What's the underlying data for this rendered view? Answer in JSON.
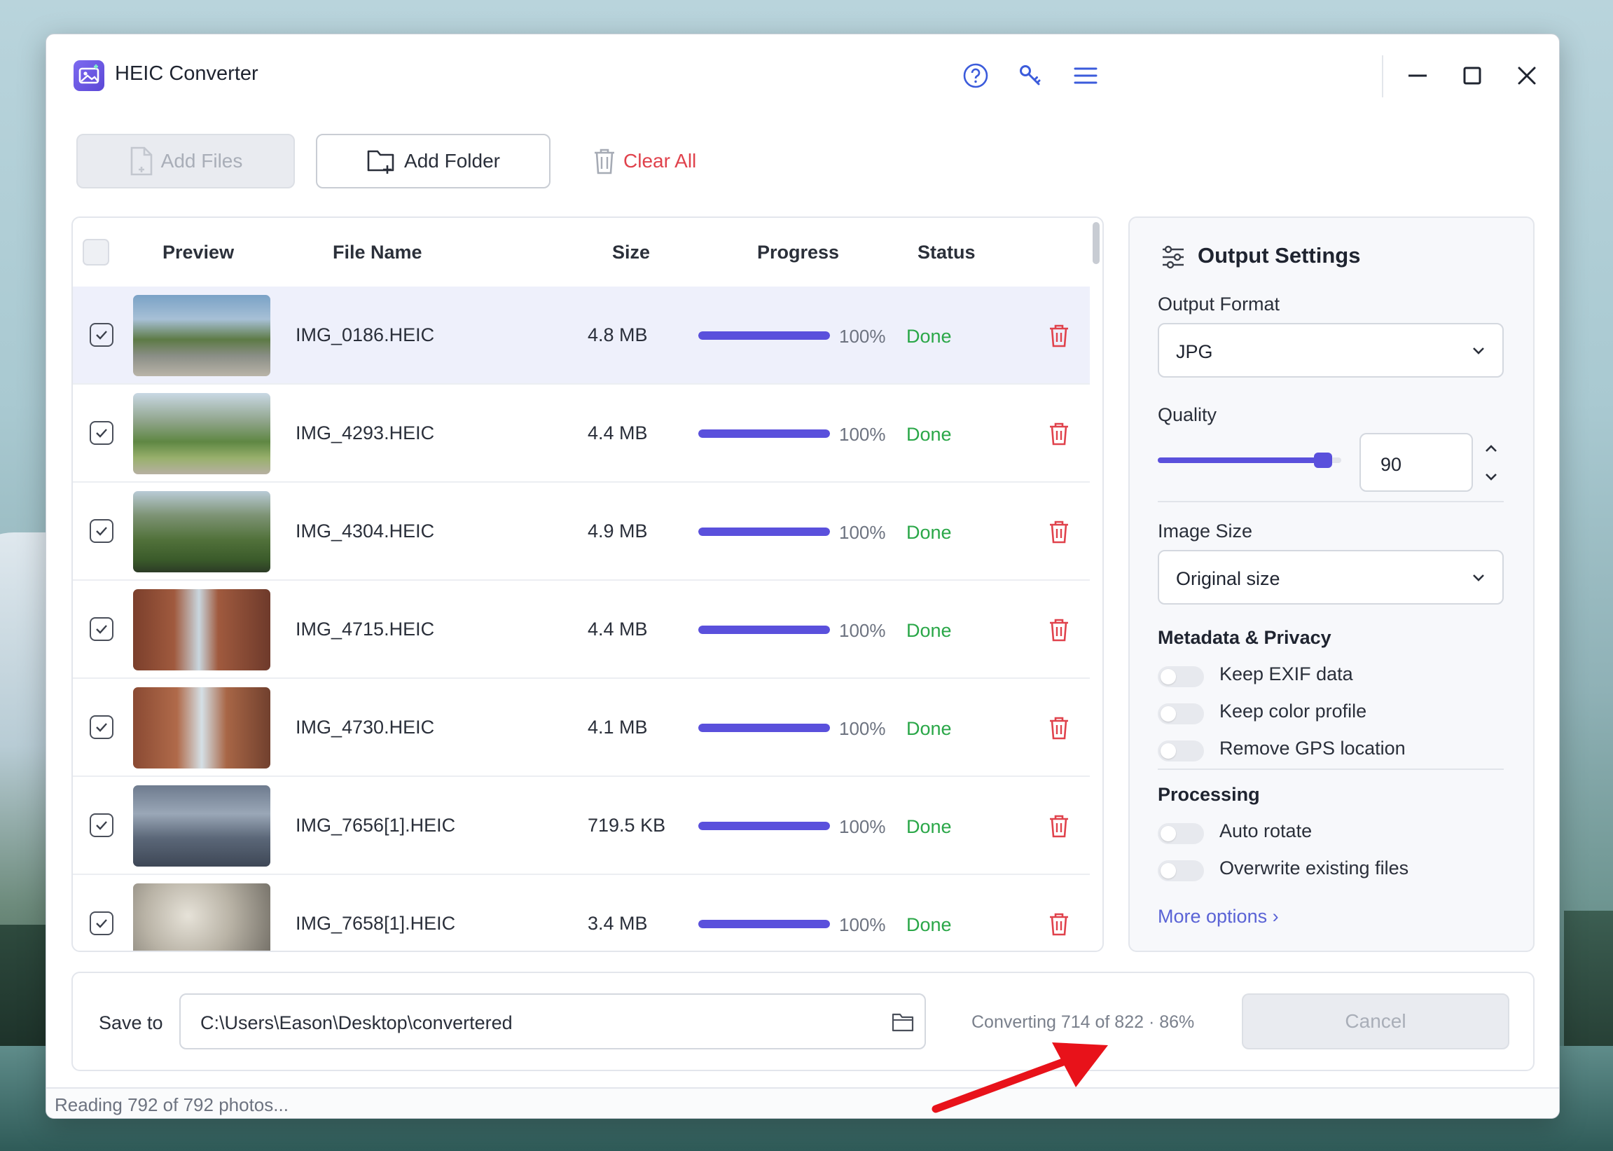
{
  "app": {
    "title": "HEIC Converter"
  },
  "toolbar": {
    "add_files": "Add Files",
    "add_folder": "Add Folder",
    "clear_all": "Clear All"
  },
  "table": {
    "headers": {
      "preview": "Preview",
      "file_name": "File Name",
      "size": "Size",
      "progress": "Progress",
      "status": "Status"
    },
    "rows": [
      {
        "name": "IMG_0186.HEIC",
        "size": "4.8 MB",
        "progress_pct": "100%",
        "progress_value": 1.0,
        "status": "Done",
        "selected": true,
        "thumb": "park-path"
      },
      {
        "name": "IMG_4293.HEIC",
        "size": "4.4 MB",
        "progress_pct": "100%",
        "progress_value": 1.0,
        "status": "Done",
        "selected": false,
        "thumb": "valley-path"
      },
      {
        "name": "IMG_4304.HEIC",
        "size": "4.9 MB",
        "progress_pct": "100%",
        "progress_value": 1.0,
        "status": "Done",
        "selected": false,
        "thumb": "green-hills"
      },
      {
        "name": "IMG_4715.HEIC",
        "size": "4.4 MB",
        "progress_pct": "100%",
        "progress_value": 1.0,
        "status": "Done",
        "selected": false,
        "thumb": "brick-street"
      },
      {
        "name": "IMG_4730.HEIC",
        "size": "4.1 MB",
        "progress_pct": "100%",
        "progress_value": 1.0,
        "status": "Done",
        "selected": false,
        "thumb": "brick-street-people"
      },
      {
        "name": "IMG_7656[1].HEIC",
        "size": "719.5 KB",
        "progress_pct": "100%",
        "progress_value": 1.0,
        "status": "Done",
        "selected": false,
        "thumb": "cloudy-sky"
      },
      {
        "name": "IMG_7658[1].HEIC",
        "size": "3.4 MB",
        "progress_pct": "100%",
        "progress_value": 1.0,
        "status": "Done",
        "selected": false,
        "thumb": "macro-closeup"
      }
    ]
  },
  "settings": {
    "title": "Output Settings",
    "output_format_label": "Output Format",
    "output_format_value": "JPG",
    "quality_label": "Quality",
    "quality_value": "90",
    "quality_slider_value": 0.9,
    "image_size_label": "Image Size",
    "image_size_value": "Original size",
    "metadata_section": "Metadata & Privacy",
    "metadata_toggles": [
      {
        "label": "Keep EXIF data",
        "on": false
      },
      {
        "label": "Keep color profile",
        "on": false
      },
      {
        "label": "Remove GPS location",
        "on": false
      }
    ],
    "processing_section": "Processing",
    "processing_toggles": [
      {
        "label": "Auto rotate",
        "on": false
      },
      {
        "label": "Overwrite existing files",
        "on": false
      }
    ],
    "more_options": "More options ›"
  },
  "bottom": {
    "save_to_label": "Save to",
    "save_path": "C:\\Users\\Eason\\Desktop\\convertered",
    "converting_status": "Converting 714 of 822 · 86%",
    "cancel": "Cancel"
  },
  "statusbar": {
    "text": "Reading 792 of 792 photos..."
  },
  "colors": {
    "accent": "#5a50dc",
    "done": "#2aa748",
    "danger": "#e0424c",
    "annotation_arrow": "#e8121a"
  }
}
